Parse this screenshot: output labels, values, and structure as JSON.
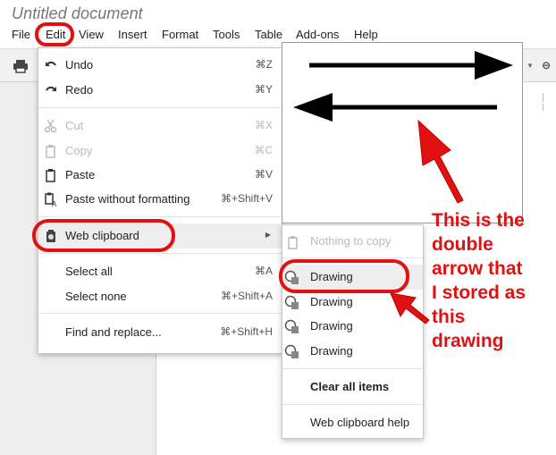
{
  "document": {
    "title": "Untitled document"
  },
  "menubar": [
    "File",
    "Edit",
    "View",
    "Insert",
    "Format",
    "Tools",
    "Table",
    "Add-ons",
    "Help"
  ],
  "edit_menu": {
    "undo": {
      "label": "Undo",
      "shortcut": "⌘Z"
    },
    "redo": {
      "label": "Redo",
      "shortcut": "⌘Y"
    },
    "cut": {
      "label": "Cut",
      "shortcut": "⌘X"
    },
    "copy": {
      "label": "Copy",
      "shortcut": "⌘C"
    },
    "paste": {
      "label": "Paste",
      "shortcut": "⌘V"
    },
    "paste_plain": {
      "label": "Paste without formatting",
      "shortcut": "⌘+Shift+V"
    },
    "web_clipboard": {
      "label": "Web clipboard"
    },
    "select_all": {
      "label": "Select all",
      "shortcut": "⌘A"
    },
    "select_none": {
      "label": "Select none",
      "shortcut": "⌘+Shift+A"
    },
    "find_replace": {
      "label": "Find and replace...",
      "shortcut": "⌘+Shift+H"
    }
  },
  "web_clipboard_menu": {
    "nothing": "Nothing to copy",
    "items": [
      "Drawing",
      "Drawing",
      "Drawing",
      "Drawing"
    ],
    "clear": "Clear all items",
    "help": "Web clipboard help"
  },
  "annotation": {
    "lines": [
      "This is the",
      "double",
      "arrow that",
      "I stored as",
      "this",
      "drawing"
    ]
  },
  "colors": {
    "annotation_red": "#e11111",
    "menu_highlight": "#eeeeee"
  }
}
